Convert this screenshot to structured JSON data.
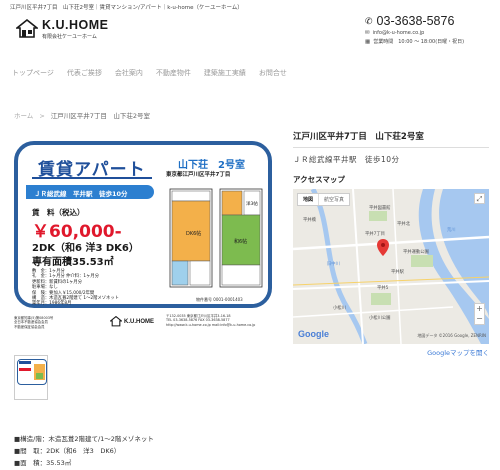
{
  "topbar": {
    "text": "江戸川区平井7丁目　山下荘2号室｜賃貸マンション/アパート｜k-u-home（ケーユーホーム）"
  },
  "header": {
    "logo_name": "K.U.HOME",
    "logo_sub": "有限会社ケーユーホーム",
    "phone": "03-3638-5876",
    "email": "info@k-u-home.co.jp",
    "hours": "営業時間　10:00 〜 18:00(日曜・祝日)"
  },
  "nav": {
    "items": [
      "トップページ",
      "代表ご挨拶",
      "会社案内",
      "不動産物件",
      "建築施工実績",
      "お問合せ"
    ]
  },
  "breadcrumb": {
    "home": "ホーム",
    "separator": ">",
    "current": "江戸川区平井7丁目　山下荘2号室"
  },
  "flyer": {
    "title": "賃貸アパート",
    "station_badge": "ＪＲ総武線　平井駅　徒歩10分",
    "rent_label": "賃　料（税込）",
    "rent": "￥60,000-",
    "layout": "2DK（和6 洋3 DK6）",
    "area": "専有面積35.53㎡",
    "details": [
      "敷　金：1ヶ月分",
      "礼　金：1ヶ月分 仲介料：1ヶ月分",
      "更新料：新賃料の1ヶ月分",
      "駐車場：なし",
      "保　険：要加入￥15,000/2年間",
      "構　造：木造瓦葺2階建て 1〜2階メゾネット",
      "築年月：1986年8月"
    ],
    "property_name": "山下荘　2号室",
    "property_address": "東京都江戸川区平井7丁目",
    "room_labels": {
      "dk": "DK6帖",
      "washitsu": "和6帖",
      "youshitsu": "洋3帖"
    },
    "property_no": "物件番号 0001-0001403",
    "footer_left": [
      "東京都知事(5)第08003号",
      "全日本不動産協会会員",
      "不動産保証協会会員"
    ],
    "footer_company": "K.U.HOME",
    "footer_right": [
      "〒132-0035 東京都江戸川区平井3-16-18",
      "TEL 03-3638-5876 FAX 03-3638-5877",
      "http://www.k-u-home.co.jp  mail:info@k-u-home.co.jp"
    ]
  },
  "specs": {
    "lines": [
      "■構造/階：木造瓦葺2階建て/1〜2階メゾネット",
      "■間　取：2DK（和6　洋3　DK6）",
      "■面　積：35.53㎡"
    ]
  },
  "sidebar": {
    "title": "江戸川区平井7丁目　山下荘2号室",
    "subtitle": "ＪＲ総武線平井駅　徒歩10分",
    "map_title": "アクセスマップ",
    "map_tab_map": "地図",
    "map_tab_satellite": "航空写真",
    "map_labels": [
      "平井橋",
      "平井図書館",
      "平井北",
      "平井7丁目",
      "旧中川",
      "平井駅",
      "平井運動公園",
      "荒川",
      "小松川",
      "平井5",
      "小松川公園"
    ],
    "map_google": "Google",
    "map_copyright": "地図データ ©2016 Google, ZENRIN",
    "map_link": "Googleマップを開く"
  },
  "colors": {
    "flyer_blue": "#2c5f9e",
    "rent_red": "#e0182c",
    "badge_blue": "#2c7fd0",
    "link_blue": "#3a79d6",
    "pin_red": "#e53935"
  }
}
